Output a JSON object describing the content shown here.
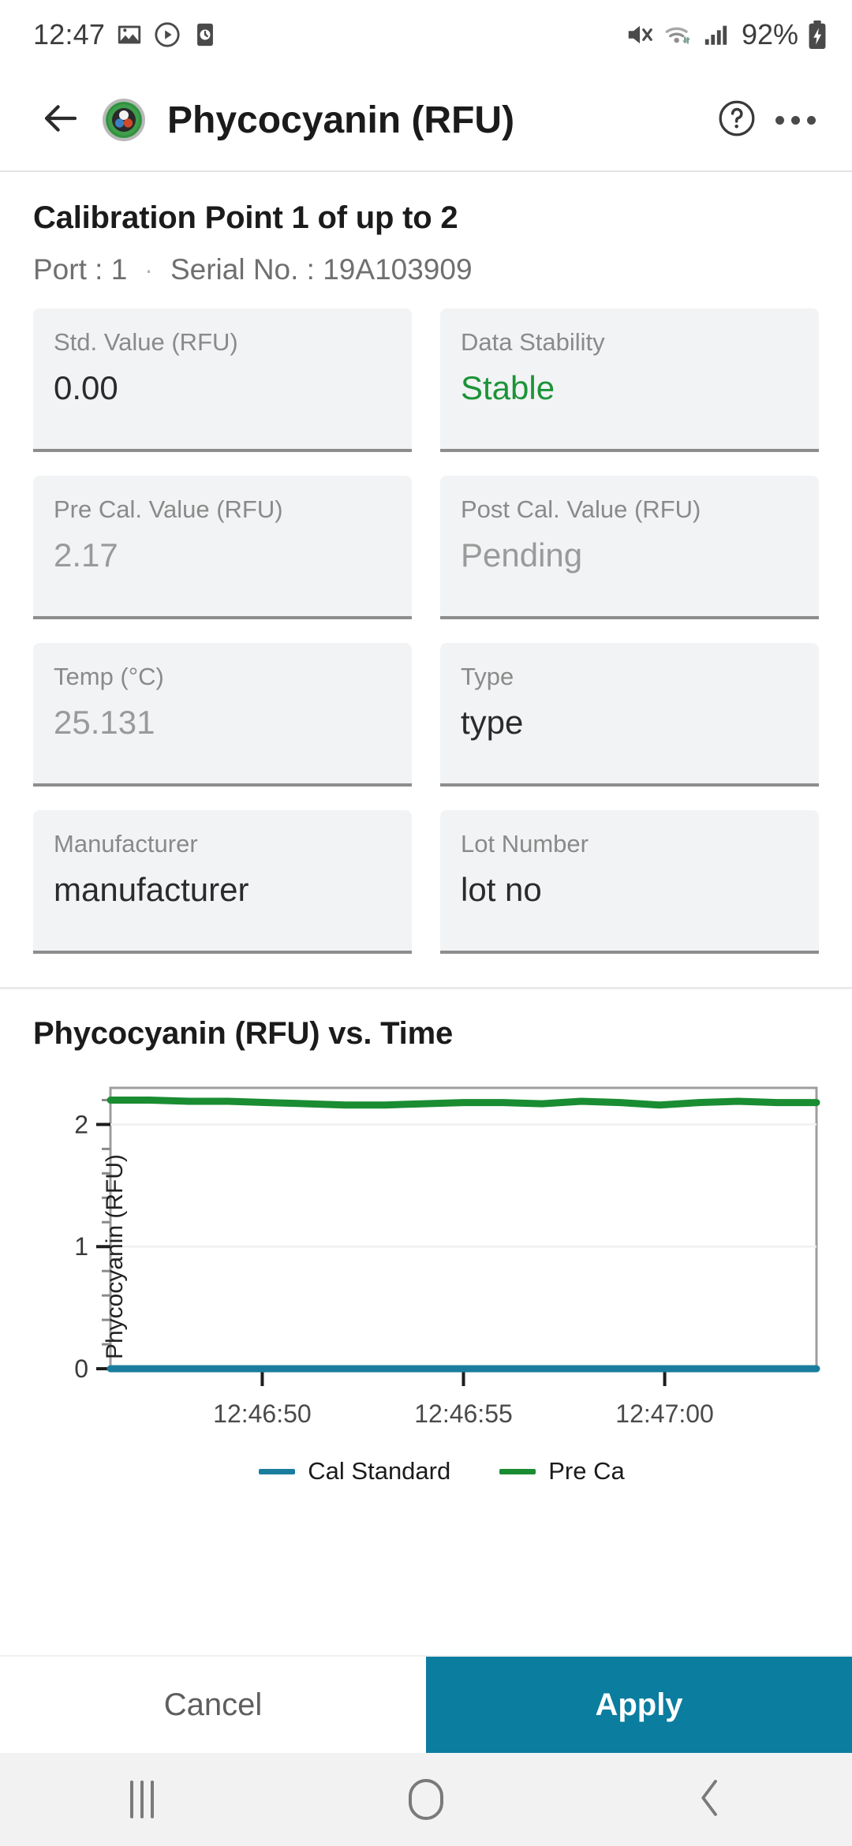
{
  "statusbar": {
    "time": "12:47",
    "battery_percent": "92%",
    "icons": [
      "gallery-icon",
      "play-icon",
      "clock-icon",
      "mute-icon",
      "wifi-icon",
      "signal-icon",
      "battery-charging-icon"
    ]
  },
  "appbar": {
    "title": "Phycocyanin (RFU)",
    "back_icon": "back-arrow-icon",
    "sensor_icon": "sensor-icon",
    "help_icon": "help-circle-icon",
    "overflow_icon": "overflow-menu-icon"
  },
  "calibration": {
    "title": "Calibration Point 1 of up to 2",
    "port_label": "Port : 1",
    "separator": "·",
    "serial_label": "Serial No. : 19A103909"
  },
  "fields": [
    {
      "label": "Std. Value (RFU)",
      "value": "0.00",
      "state": "editable"
    },
    {
      "label": "Data Stability",
      "value": "Stable",
      "state": "ok"
    },
    {
      "label": "Pre Cal. Value (RFU)",
      "value": "2.17",
      "state": "dim"
    },
    {
      "label": "Post Cal. Value (RFU)",
      "value": "Pending",
      "state": "dim"
    },
    {
      "label": "Temp (°C)",
      "value": "25.131",
      "state": "dim"
    },
    {
      "label": "Type",
      "value": "type",
      "state": "editable"
    },
    {
      "label": "Manufacturer",
      "value": "manufacturer",
      "state": "editable"
    },
    {
      "label": "Lot Number",
      "value": "lot no",
      "state": "editable"
    }
  ],
  "chart_data": {
    "type": "line",
    "title": "Phycocyanin (RFU) vs. Time",
    "xlabel": "",
    "ylabel": "Phycocyanin (RFU)",
    "xticks": [
      "12:46:50",
      "12:46:55",
      "12:47:00"
    ],
    "yticks": [
      "0",
      "1",
      "2"
    ],
    "ylim": [
      0,
      2.3
    ],
    "grid": true,
    "legend_position": "bottom",
    "x": [
      0,
      1,
      2,
      3,
      4,
      5,
      6,
      7,
      8,
      9,
      10,
      11,
      12,
      13,
      14,
      15,
      16,
      17,
      18
    ],
    "series": [
      {
        "name": "Cal Standard",
        "color": "#1b7d9e",
        "values": [
          0,
          0,
          0,
          0,
          0,
          0,
          0,
          0,
          0,
          0,
          0,
          0,
          0,
          0,
          0,
          0,
          0,
          0,
          0
        ]
      },
      {
        "name": "Pre Ca",
        "color": "#1a8c32",
        "values": [
          2.2,
          2.2,
          2.19,
          2.19,
          2.18,
          2.17,
          2.16,
          2.16,
          2.17,
          2.18,
          2.18,
          2.17,
          2.19,
          2.18,
          2.16,
          2.18,
          2.19,
          2.18,
          2.18
        ]
      }
    ]
  },
  "actions": {
    "cancel_label": "Cancel",
    "apply_label": "Apply",
    "apply_color": "#0b7d9f"
  },
  "navbar": {
    "recents_icon": "recents-icon",
    "home_icon": "home-icon",
    "back_icon": "nav-back-icon"
  }
}
